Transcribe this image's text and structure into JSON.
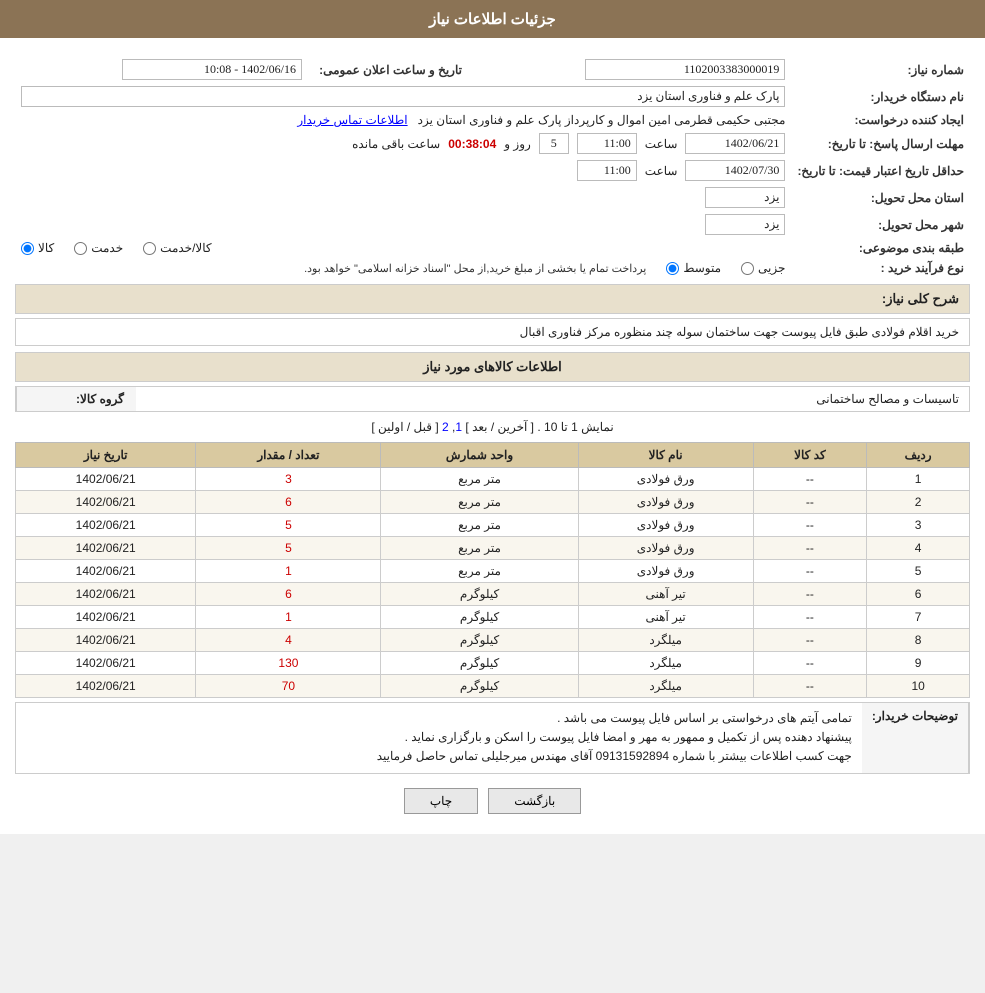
{
  "header": {
    "title": "جزئيات اطلاعات نياز"
  },
  "form": {
    "request_number_label": "شماره نياز:",
    "request_number_value": "1102003383000019",
    "buyer_org_label": "نام دستگاه خريدار:",
    "buyer_org_value": "پارک علم و فناوری استان يزد",
    "creator_label": "ايجاد کننده درخواست:",
    "creator_value": "مجتبی حکیمی قطرمی امین اموال و کارپرداز پارک علم و فناوری استان یزد",
    "creator_link": "اطلاعات تماس خريدار",
    "announce_date_label": "تاريخ و ساعت اعلان عمومی:",
    "announce_date_value": "1402/06/16 - 10:08",
    "reply_deadline_label": "مهلت ارسال پاسخ: تا تاريخ:",
    "reply_date_value": "1402/06/21",
    "reply_time_label": "ساعت",
    "reply_time_value": "11:00",
    "reply_days_label": "روز و",
    "reply_days_value": "5",
    "countdown_label": "ساعت باقی مانده",
    "countdown_value": "00:38:04",
    "price_validity_label": "حداقل تاريخ اعتبار قيمت: تا تاريخ:",
    "price_validity_date": "1402/07/30",
    "price_validity_time_label": "ساعت",
    "price_validity_time": "11:00",
    "province_label": "استان محل تحويل:",
    "province_value": "يزد",
    "city_label": "شهر محل تحويل:",
    "city_value": "يزد",
    "category_label": "طبقه بندی موضوعی:",
    "category_options": [
      "کالا",
      "خدمت",
      "کالا/خدمت"
    ],
    "category_selected": "کالا",
    "purchase_type_label": "نوع فرآيند خريد :",
    "purchase_type_options": [
      "جزيی",
      "متوسط"
    ],
    "purchase_type_selected": "متوسط",
    "purchase_note": "پرداخت تمام يا بخشی از مبلغ خريد,از محل \"اسناد خزانه اسلامی\" خواهد بود.",
    "general_desc_label": "شرح کلی نياز:",
    "general_desc_value": "خريد اقلام فولادی طبق فایل پیوست جهت ساختمان سوله چند منظوره مرکز فناوری اقبال",
    "goods_info_label": "اطلاعات کالاهای مورد نياز",
    "goods_group_label": "گروه کالا:",
    "goods_group_value": "تاسیسات و مصالح ساختمانی",
    "pagination_text": "نمايش 1 تا 10 . [ آخرين / بعد ]",
    "pagination_pages": "1, 2",
    "pagination_prev": "[ قبل / اولين ]",
    "table": {
      "headers": [
        "رديف",
        "کد کالا",
        "نام کالا",
        "واحد شمارش",
        "تعداد / مقدار",
        "تاريخ نياز"
      ],
      "rows": [
        {
          "row": "1",
          "code": "--",
          "name": "ورق فولادی",
          "unit": "متر مربع",
          "qty": "3",
          "date": "1402/06/21"
        },
        {
          "row": "2",
          "code": "--",
          "name": "ورق فولادی",
          "unit": "متر مربع",
          "qty": "6",
          "date": "1402/06/21"
        },
        {
          "row": "3",
          "code": "--",
          "name": "ورق فولادی",
          "unit": "متر مربع",
          "qty": "5",
          "date": "1402/06/21"
        },
        {
          "row": "4",
          "code": "--",
          "name": "ورق فولادی",
          "unit": "متر مربع",
          "qty": "5",
          "date": "1402/06/21"
        },
        {
          "row": "5",
          "code": "--",
          "name": "ورق فولادی",
          "unit": "متر مربع",
          "qty": "1",
          "date": "1402/06/21"
        },
        {
          "row": "6",
          "code": "--",
          "name": "تیر آهنی",
          "unit": "کیلوگرم",
          "qty": "6",
          "date": "1402/06/21"
        },
        {
          "row": "7",
          "code": "--",
          "name": "تیر آهنی",
          "unit": "کیلوگرم",
          "qty": "1",
          "date": "1402/06/21"
        },
        {
          "row": "8",
          "code": "--",
          "name": "میلگرد",
          "unit": "کیلوگرم",
          "qty": "4",
          "date": "1402/06/21"
        },
        {
          "row": "9",
          "code": "--",
          "name": "میلگرد",
          "unit": "کیلوگرم",
          "qty": "130",
          "date": "1402/06/21"
        },
        {
          "row": "10",
          "code": "--",
          "name": "میلگرد",
          "unit": "کیلوگرم",
          "qty": "70",
          "date": "1402/06/21"
        }
      ]
    },
    "buyer_desc_label": "توضيحات خريدار:",
    "buyer_desc_lines": [
      "تمامی آیتم های درخواستی بر اساس فایل پیوست می باشد .",
      "پیشنهاد دهنده پس از تکمیل و ممهور به مهر و امضا فایل پیوست را اسکن و بارگزاری نماید .",
      "جهت کسب اطلاعات بیشتر با شماره  09131592894  آقای مهندس میرجلیلی تماس حاصل فرمایید"
    ],
    "btn_back": "بازگشت",
    "btn_print": "چاپ"
  }
}
